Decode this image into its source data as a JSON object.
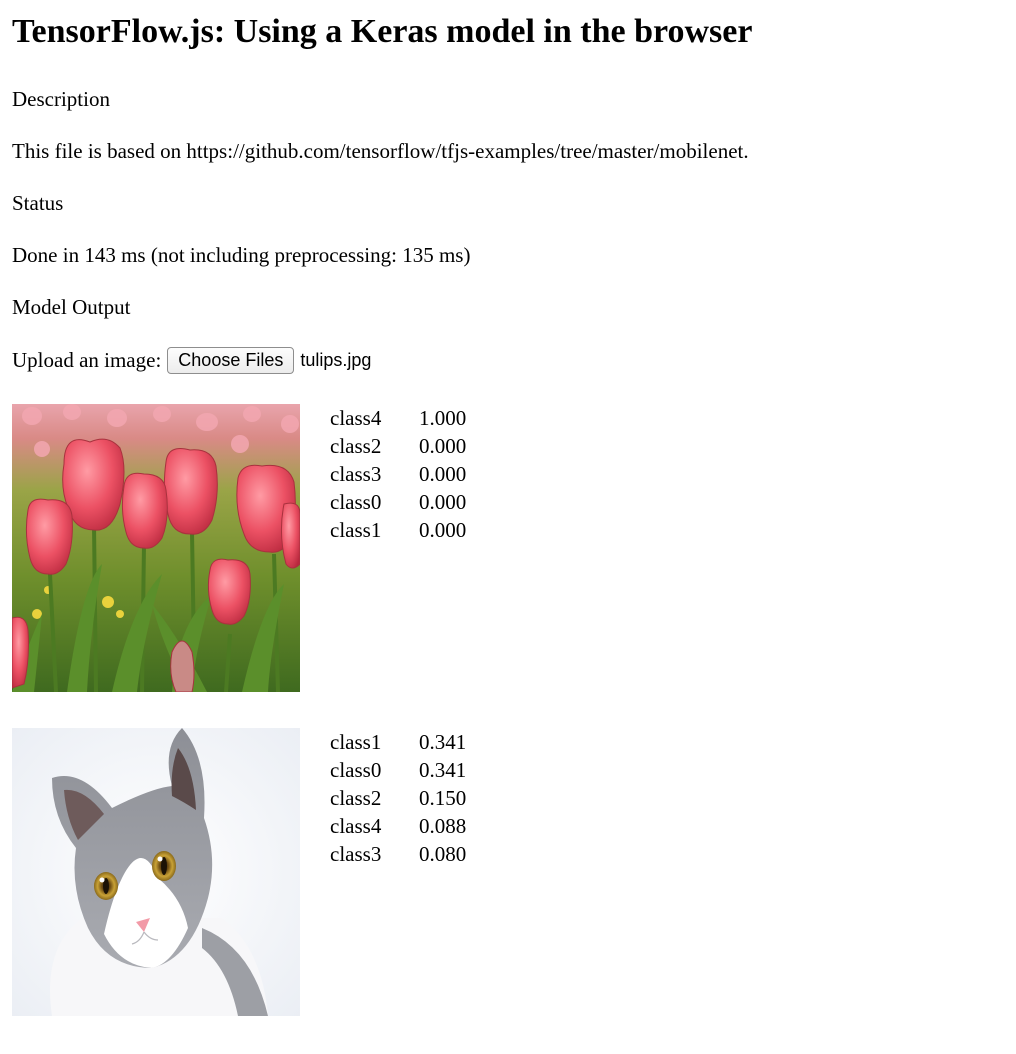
{
  "header": {
    "title": "TensorFlow.js: Using a Keras model in the browser"
  },
  "description": {
    "heading": "Description",
    "text": "This file is based on https://github.com/tensorflow/tfjs-examples/tree/master/mobilenet."
  },
  "status": {
    "heading": "Status",
    "text": "Done in 143 ms (not including preprocessing: 135 ms)"
  },
  "output": {
    "heading": "Model Output"
  },
  "upload": {
    "label": "Upload an image:",
    "button_label": "Choose Files",
    "file_name": "tulips.jpg"
  },
  "predictions": [
    {
      "image_subject": "tulips photo",
      "rows": [
        {
          "class": "class4",
          "prob": "1.000"
        },
        {
          "class": "class2",
          "prob": "0.000"
        },
        {
          "class": "class3",
          "prob": "0.000"
        },
        {
          "class": "class0",
          "prob": "0.000"
        },
        {
          "class": "class1",
          "prob": "0.000"
        }
      ]
    },
    {
      "image_subject": "cat photo",
      "rows": [
        {
          "class": "class1",
          "prob": "0.341"
        },
        {
          "class": "class0",
          "prob": "0.341"
        },
        {
          "class": "class2",
          "prob": "0.150"
        },
        {
          "class": "class4",
          "prob": "0.088"
        },
        {
          "class": "class3",
          "prob": "0.080"
        }
      ]
    }
  ]
}
